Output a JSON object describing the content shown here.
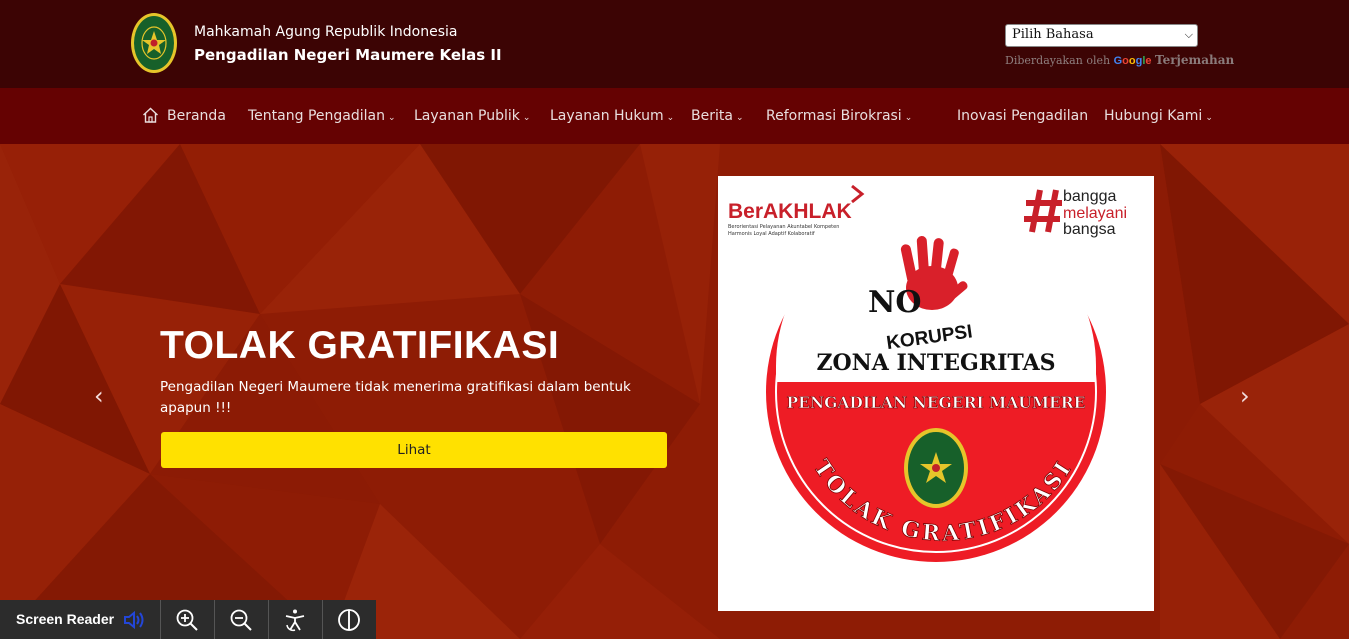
{
  "header": {
    "org": "Mahkamah Agung Republik Indonesia",
    "court": "Pengadilan Negeri Maumere Kelas II",
    "language_select": "Pilih Bahasa",
    "powered_by": "Diberdayakan oleh",
    "google": "Google",
    "translate": "Terjemahan"
  },
  "nav": {
    "items": [
      {
        "label": "Beranda"
      },
      {
        "label": "Tentang Pengadilan"
      },
      {
        "label": "Layanan Publik"
      },
      {
        "label": "Layanan Hukum"
      },
      {
        "label": "Berita"
      },
      {
        "label": "Reformasi Birokrasi"
      },
      {
        "label": "Inovasi Pengadilan"
      },
      {
        "label": "Hubungi Kami"
      }
    ]
  },
  "hero": {
    "title": "TOLAK GRATIFIKASI",
    "description": "Pengadilan Negeri Maumere tidak menerima gratifikasi dalam bentuk apapun !!!",
    "button": "Lihat"
  },
  "poster": {
    "berakhlak": "BerAKHLAK",
    "berakhlak_sub1": "Berorientasi Pelayanan Akuntabel Kompeten",
    "berakhlak_sub2": "Harmonis Loyal Adaptif Kolaboratif",
    "bangga1": "bangga",
    "bangga2": "melayani",
    "bangga3": "bangsa",
    "no": "NO",
    "korupsi": "KORUPSI",
    "zona": "ZONA INTEGRITAS",
    "court": "PENGADILAN NEGERI MAUMERE",
    "tolak": "TOLAK GRATIFIKASI"
  },
  "accessibility": {
    "screen_reader": "Screen Reader"
  },
  "colors": {
    "topbar": "#3c0404",
    "nav": "#650202",
    "hero": "#8e1c05",
    "button": "#ffe100",
    "poster_red": "#ee1c25"
  }
}
